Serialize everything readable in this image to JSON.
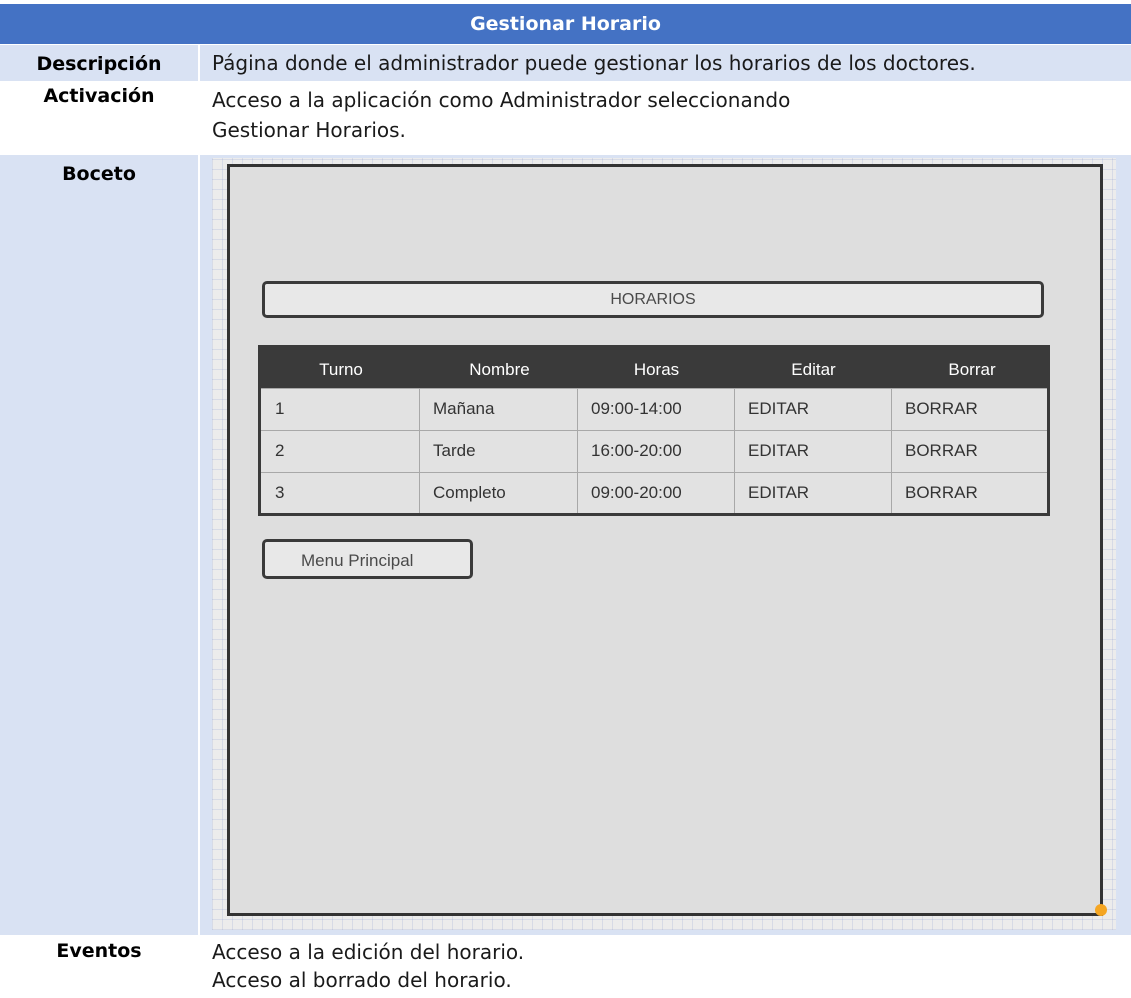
{
  "document": {
    "title": "Gestionar Horario",
    "rows": {
      "descripcion": {
        "label": "Descripción",
        "value": "Página donde el administrador puede gestionar los horarios de los doctores."
      },
      "activacion": {
        "label": "Activación",
        "value": "Acceso a la aplicación como Administrador seleccionando Gestionar Horarios."
      },
      "boceto": {
        "label": "Boceto"
      },
      "eventos": {
        "label": "Eventos",
        "lines": [
          "Acceso a la edición del horario.",
          "Acceso al borrado del horario."
        ]
      }
    }
  },
  "mockup": {
    "heading": "HORARIOS",
    "table": {
      "headers": [
        "Turno",
        "Nombre",
        "Horas",
        "Editar",
        "Borrar"
      ],
      "rows": [
        [
          "1",
          "Mañana",
          "09:00-14:00",
          "EDITAR",
          "BORRAR"
        ],
        [
          "2",
          "Tarde",
          "16:00-20:00",
          "EDITAR",
          "BORRAR"
        ],
        [
          "3",
          "Completo",
          "09:00-20:00",
          "EDITAR",
          "BORRAR"
        ]
      ]
    },
    "menu_button": "Menu Principal"
  },
  "colors": {
    "header_blue": "#4472c4",
    "cell_light_blue": "#d9e2f3",
    "sketch_dark": "#3a3a3a",
    "sketch_bg": "#dedede",
    "corner_handle": "#f5a623"
  }
}
